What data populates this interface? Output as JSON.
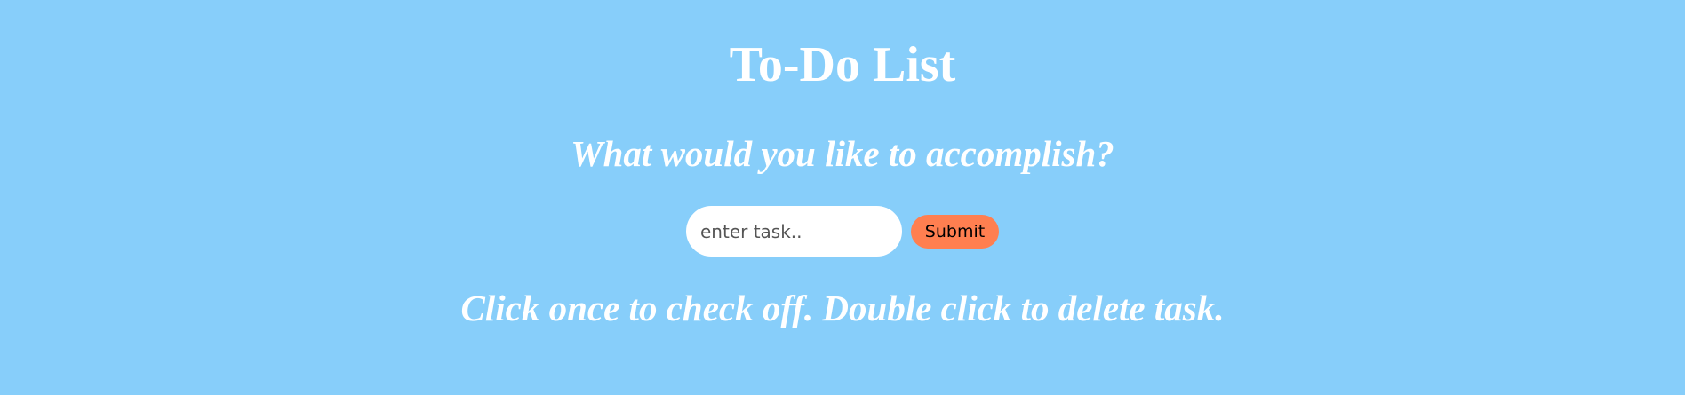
{
  "page": {
    "title": "To-Do List",
    "subtitle": "What would you like to accomplish?",
    "instructions": "Click once to check off. Double click to delete task."
  },
  "form": {
    "input_value": "",
    "input_placeholder": "enter task..",
    "submit_label": "Submit"
  },
  "tasks": [],
  "colors": {
    "background": "#87cefa",
    "text": "#ffffff",
    "submit_button": "#ff7f50",
    "input_background": "#ffffff"
  }
}
